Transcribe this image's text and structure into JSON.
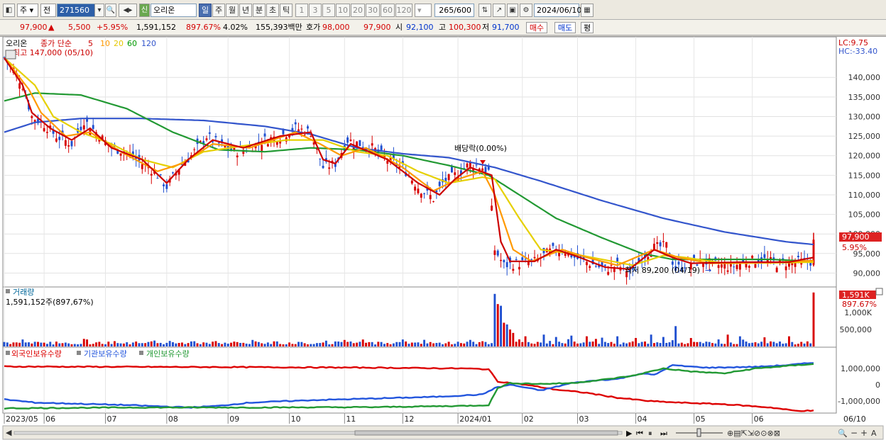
{
  "toolbar": {
    "market": "주",
    "period_label": "전",
    "code": "271560",
    "new_badge": "신",
    "name": "오리온",
    "period_buttons": [
      "일",
      "주",
      "월",
      "년",
      "분",
      "초",
      "틱"
    ],
    "active_period": "일",
    "interval_buttons": [
      "1",
      "3",
      "5",
      "10",
      "20",
      "30",
      "60",
      "120"
    ],
    "count": "265",
    "count_total": "/600",
    "date": "2024/06/10"
  },
  "quote": {
    "price": "97,900",
    "change_arrow": "▲",
    "change": "5,500",
    "change_pct": "+5.95%",
    "volume": "1,591,152",
    "volume_ratio": "897.67%",
    "turnover": "4.02%",
    "amount": "155,393백만",
    "ask_label": "호가",
    "ask1": "98,000",
    "ask2": "97,900",
    "open_label": "시",
    "open": "92,100",
    "high_label": "고",
    "high": "100,300",
    "low_label": "저",
    "low": "91,700",
    "buy_label": "매수",
    "sell_label": "매도",
    "avg_label": "평"
  },
  "chart_data": {
    "type": "line",
    "title": "오리온",
    "ma_legend": {
      "label": "종가 단순",
      "periods": [
        "5",
        "10",
        "20",
        "60",
        "120"
      ],
      "colors": [
        "#cc0000",
        "#ff9900",
        "#e6c800",
        "#009900",
        "#3355cc"
      ]
    },
    "price_high_label": "최고 147,000 (05/10)",
    "price_low_label": "최저 89,200 (04/19)",
    "dividend_label": "배당락(0.00%)",
    "lc_label": "LC:9.75",
    "hc_label": "HC:-33.40",
    "last_price_tag": "97,900",
    "last_pct_tag": "5.95%",
    "ylim": [
      87000,
      150000
    ],
    "y_ticks": [
      "140,000",
      "135,000",
      "130,000",
      "125,000",
      "120,000",
      "115,000",
      "110,000",
      "105,000",
      "100,000",
      "95,000",
      "90,000"
    ],
    "y_tick_values": [
      140000,
      135000,
      130000,
      125000,
      120000,
      115000,
      110000,
      105000,
      100000,
      95000,
      90000
    ],
    "x_labels": [
      "2023/05",
      "06",
      "07",
      "08",
      "09",
      "10",
      "11",
      "12",
      "2024/01",
      "02",
      "03",
      "04",
      "05",
      "06"
    ],
    "x_label_index": [
      0,
      13,
      33,
      53,
      73,
      93,
      111,
      130,
      148,
      169,
      187,
      206,
      225,
      244
    ],
    "n": 265,
    "close_anchors": [
      [
        0,
        145000
      ],
      [
        3,
        142000
      ],
      [
        6,
        138000
      ],
      [
        9,
        130000
      ],
      [
        13,
        128000
      ],
      [
        17,
        125000
      ],
      [
        22,
        123000
      ],
      [
        26,
        129000
      ],
      [
        30,
        126000
      ],
      [
        35,
        122000
      ],
      [
        40,
        121000
      ],
      [
        45,
        118000
      ],
      [
        49,
        116000
      ],
      [
        53,
        112000
      ],
      [
        57,
        117000
      ],
      [
        61,
        120000
      ],
      [
        66,
        125000
      ],
      [
        70,
        123000
      ],
      [
        75,
        121000
      ],
      [
        80,
        122000
      ],
      [
        85,
        124000
      ],
      [
        90,
        125000
      ],
      [
        95,
        127000
      ],
      [
        100,
        126000
      ],
      [
        104,
        117000
      ],
      [
        108,
        118000
      ],
      [
        112,
        124000
      ],
      [
        116,
        123000
      ],
      [
        120,
        122000
      ],
      [
        125,
        119000
      ],
      [
        130,
        117000
      ],
      [
        135,
        112000
      ],
      [
        140,
        109000
      ],
      [
        143,
        113000
      ],
      [
        147,
        115000
      ],
      [
        152,
        118000
      ],
      [
        156,
        117000
      ],
      [
        158,
        116000
      ],
      [
        160,
        96000
      ],
      [
        163,
        92000
      ],
      [
        168,
        92500
      ],
      [
        173,
        93000
      ],
      [
        178,
        95500
      ],
      [
        182,
        96500
      ],
      [
        186,
        94000
      ],
      [
        191,
        92500
      ],
      [
        196,
        91000
      ],
      [
        200,
        92000
      ],
      [
        205,
        90000
      ],
      [
        208,
        94000
      ],
      [
        212,
        96500
      ],
      [
        216,
        97000
      ],
      [
        219,
        91000
      ],
      [
        223,
        92500
      ],
      [
        228,
        93000
      ],
      [
        233,
        92000
      ],
      [
        237,
        91500
      ],
      [
        242,
        93000
      ],
      [
        247,
        93500
      ],
      [
        252,
        92500
      ],
      [
        258,
        92800
      ],
      [
        263,
        93000
      ],
      [
        264,
        97900
      ]
    ],
    "ma5_anchors": [
      [
        0,
        145000
      ],
      [
        6,
        138000
      ],
      [
        9,
        131000
      ],
      [
        15,
        127000
      ],
      [
        22,
        124000
      ],
      [
        28,
        127000
      ],
      [
        35,
        122000
      ],
      [
        45,
        119000
      ],
      [
        53,
        113000
      ],
      [
        60,
        119000
      ],
      [
        68,
        124000
      ],
      [
        78,
        122000
      ],
      [
        90,
        125000
      ],
      [
        100,
        126000
      ],
      [
        104,
        119000
      ],
      [
        108,
        118000
      ],
      [
        113,
        123000
      ],
      [
        125,
        119000
      ],
      [
        135,
        113000
      ],
      [
        142,
        110000
      ],
      [
        147,
        114000
      ],
      [
        152,
        117000
      ],
      [
        159,
        115000
      ],
      [
        162,
        98000
      ],
      [
        165,
        93000
      ],
      [
        173,
        93000
      ],
      [
        180,
        96000
      ],
      [
        186,
        94500
      ],
      [
        196,
        91500
      ],
      [
        204,
        91000
      ],
      [
        212,
        96000
      ],
      [
        218,
        94000
      ],
      [
        224,
        92500
      ],
      [
        240,
        92800
      ],
      [
        256,
        92800
      ],
      [
        264,
        94000
      ]
    ],
    "ma10_anchors": [
      [
        0,
        145000
      ],
      [
        8,
        137000
      ],
      [
        12,
        131000
      ],
      [
        20,
        125000
      ],
      [
        28,
        126000
      ],
      [
        38,
        121000
      ],
      [
        50,
        116000
      ],
      [
        58,
        118000
      ],
      [
        68,
        123000
      ],
      [
        80,
        122000
      ],
      [
        95,
        126000
      ],
      [
        103,
        123000
      ],
      [
        110,
        120000
      ],
      [
        118,
        122000
      ],
      [
        130,
        117000
      ],
      [
        140,
        111000
      ],
      [
        148,
        114000
      ],
      [
        156,
        116000
      ],
      [
        160,
        110000
      ],
      [
        166,
        96000
      ],
      [
        172,
        93000
      ],
      [
        182,
        96000
      ],
      [
        190,
        94000
      ],
      [
        200,
        92000
      ],
      [
        212,
        96000
      ],
      [
        220,
        94000
      ],
      [
        230,
        92500
      ],
      [
        250,
        92700
      ],
      [
        264,
        93200
      ]
    ],
    "ma20_anchors": [
      [
        0,
        145000
      ],
      [
        10,
        138000
      ],
      [
        16,
        130000
      ],
      [
        25,
        126000
      ],
      [
        35,
        123000
      ],
      [
        45,
        119000
      ],
      [
        55,
        117000
      ],
      [
        65,
        121000
      ],
      [
        78,
        122500
      ],
      [
        92,
        124000
      ],
      [
        104,
        124000
      ],
      [
        115,
        121000
      ],
      [
        125,
        120000
      ],
      [
        135,
        116000
      ],
      [
        145,
        113000
      ],
      [
        156,
        114500
      ],
      [
        160,
        114000
      ],
      [
        168,
        104000
      ],
      [
        175,
        96000
      ],
      [
        185,
        95000
      ],
      [
        195,
        93500
      ],
      [
        205,
        92000
      ],
      [
        215,
        94500
      ],
      [
        222,
        94000
      ],
      [
        235,
        92500
      ],
      [
        250,
        92600
      ],
      [
        264,
        92800
      ]
    ],
    "ma60_anchors": [
      [
        0,
        134000
      ],
      [
        10,
        136000
      ],
      [
        25,
        135500
      ],
      [
        40,
        132000
      ],
      [
        55,
        126000
      ],
      [
        70,
        121500
      ],
      [
        85,
        121000
      ],
      [
        100,
        122000
      ],
      [
        115,
        121500
      ],
      [
        130,
        120000
      ],
      [
        145,
        117500
      ],
      [
        158,
        115000
      ],
      [
        170,
        109000
      ],
      [
        180,
        104000
      ],
      [
        195,
        99000
      ],
      [
        208,
        95000
      ],
      [
        218,
        93500
      ],
      [
        230,
        93500
      ],
      [
        250,
        93500
      ],
      [
        264,
        93000
      ]
    ],
    "ma120_anchors": [
      [
        0,
        126000
      ],
      [
        10,
        128500
      ],
      [
        25,
        129500
      ],
      [
        45,
        129500
      ],
      [
        65,
        129000
      ],
      [
        85,
        127500
      ],
      [
        100,
        125500
      ],
      [
        115,
        122000
      ],
      [
        130,
        120500
      ],
      [
        145,
        119500
      ],
      [
        160,
        117000
      ],
      [
        175,
        113500
      ],
      [
        195,
        108500
      ],
      [
        215,
        104000
      ],
      [
        235,
        100500
      ],
      [
        255,
        98000
      ],
      [
        264,
        97300
      ]
    ],
    "volume_panel": {
      "label": "거래량",
      "value_text": "1,591,152주(897,67%)",
      "last_tag": "1,591K",
      "last_pct": "897.67%",
      "ylim": [
        0,
        1650000
      ],
      "y_ticks": [
        "1,000K",
        "500,000"
      ],
      "y_tick_values": [
        1000000,
        500000
      ],
      "last_value": 1591152,
      "spike_values": [
        [
          160,
          1550000
        ],
        [
          161,
          1250000
        ],
        [
          162,
          1200000
        ],
        [
          163,
          700000
        ],
        [
          164,
          650000
        ],
        [
          165,
          500000
        ],
        [
          166,
          400000
        ],
        [
          170,
          300000
        ],
        [
          176,
          350000
        ],
        [
          180,
          280000
        ],
        [
          185,
          320000
        ],
        [
          190,
          300000
        ],
        [
          195,
          260000
        ],
        [
          200,
          300000
        ],
        [
          206,
          250000
        ],
        [
          211,
          350000
        ],
        [
          215,
          280000
        ],
        [
          219,
          600000
        ],
        [
          224,
          250000
        ],
        [
          236,
          350000
        ],
        [
          240,
          300000
        ],
        [
          248,
          270000
        ],
        [
          256,
          300000
        ],
        [
          264,
          1591152
        ]
      ]
    },
    "holdings_panel": {
      "labels": [
        "외국인보유수량",
        "기관보유수량",
        "개인보유수량"
      ],
      "colors": [
        "#dd0000",
        "#2255dd",
        "#229933"
      ],
      "ylim": [
        -1700000,
        1700000
      ],
      "y_ticks": [
        "1,000,000",
        "0",
        "-1,000,000"
      ],
      "y_tick_values": [
        1000000,
        0,
        -1000000
      ],
      "foreign_anchors": [
        [
          0,
          1120000
        ],
        [
          40,
          1100000
        ],
        [
          80,
          1080000
        ],
        [
          120,
          1050000
        ],
        [
          150,
          1000000
        ],
        [
          158,
          950000
        ],
        [
          161,
          200000
        ],
        [
          170,
          0
        ],
        [
          180,
          -300000
        ],
        [
          190,
          -500000
        ],
        [
          200,
          -800000
        ],
        [
          210,
          -1000000
        ],
        [
          220,
          -1100000
        ],
        [
          235,
          -1200000
        ],
        [
          250,
          -1400000
        ],
        [
          258,
          -1600000
        ],
        [
          264,
          -1600000
        ]
      ],
      "institution_anchors": [
        [
          0,
          -900000
        ],
        [
          10,
          -1100000
        ],
        [
          20,
          -1150000
        ],
        [
          40,
          -1250000
        ],
        [
          60,
          -1400000
        ],
        [
          70,
          -1300000
        ],
        [
          80,
          -1100000
        ],
        [
          100,
          -950000
        ],
        [
          120,
          -850000
        ],
        [
          140,
          -750000
        ],
        [
          156,
          -600000
        ],
        [
          160,
          -200000
        ],
        [
          165,
          0
        ],
        [
          175,
          -350000
        ],
        [
          185,
          100000
        ],
        [
          195,
          300000
        ],
        [
          200,
          350000
        ],
        [
          208,
          700000
        ],
        [
          212,
          600000
        ],
        [
          218,
          1200000
        ],
        [
          225,
          1100000
        ],
        [
          230,
          1050000
        ],
        [
          245,
          1100000
        ],
        [
          255,
          1200000
        ],
        [
          264,
          1350000
        ]
      ],
      "individual_anchors": [
        [
          0,
          -1450000
        ],
        [
          40,
          -1400000
        ],
        [
          80,
          -1400000
        ],
        [
          120,
          -1380000
        ],
        [
          150,
          -1300000
        ],
        [
          158,
          -1250000
        ],
        [
          161,
          -200000
        ],
        [
          165,
          100000
        ],
        [
          175,
          50000
        ],
        [
          185,
          100000
        ],
        [
          195,
          300000
        ],
        [
          205,
          550000
        ],
        [
          215,
          1000000
        ],
        [
          225,
          800000
        ],
        [
          235,
          700000
        ],
        [
          245,
          1000000
        ],
        [
          255,
          1150000
        ],
        [
          264,
          1280000
        ]
      ]
    }
  }
}
